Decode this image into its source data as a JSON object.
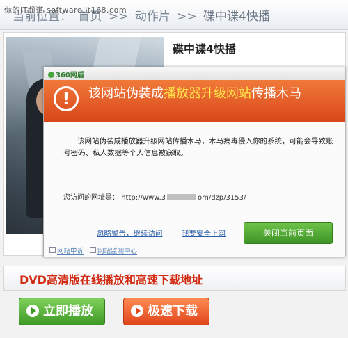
{
  "watermark": "你的IT频道 software.it168.com",
  "breadcrumb": {
    "items": [
      "当前位置：",
      "首页",
      ">>",
      "动作片",
      ">>"
    ],
    "current": "碟中谍4快播"
  },
  "product": {
    "title": "碟中谍4快播"
  },
  "dialog": {
    "logo": "360网盾",
    "headline_prefix": "该网站伪装成",
    "headline_highlight": "播放器升级网站",
    "headline_suffix": "传播木马",
    "body": "该网站伪装成播放器升级网站传播木马，木马病毒侵入你的系统，可能会导致账号密码、私人数据等个人信息被窃取。",
    "url_label": "您访问的网址是：",
    "url_prefix": "http://www.3",
    "url_suffix": "om/dzp/3153/",
    "ignore_link": "忽略警告，继续访问",
    "safe_link": "我要安全上网",
    "close_button": "关闭当前页面",
    "footer_report": "网站申诉",
    "footer_center": "网站监测中心",
    "colors": {
      "header": "#e05a22",
      "highlight": "#ffe34a",
      "close_button": "#4aa82f"
    }
  },
  "bottom": {
    "dvd_title": "DVD高清版在线播放和高速下载地址",
    "play_button": "立即播放",
    "download_button": "极速下载"
  }
}
